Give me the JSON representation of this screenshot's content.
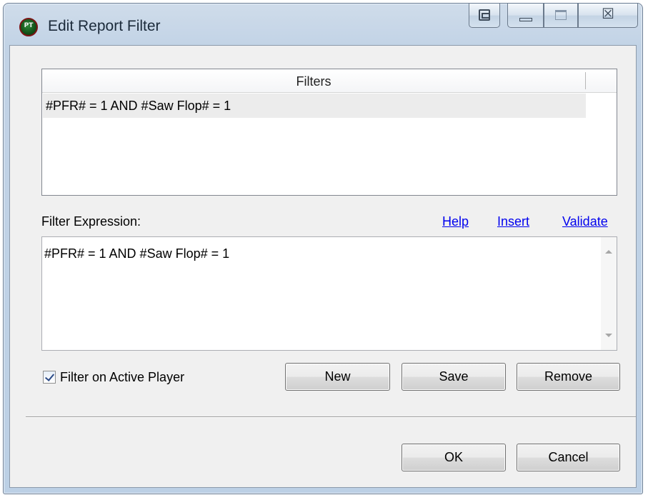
{
  "window": {
    "title": "Edit Report Filter",
    "icon": "app-logo-icon",
    "controls": {
      "extra_icon": "restore-window-icon",
      "minimize_icon": "minimize-icon",
      "maximize_icon": "maximize-icon",
      "close_glyph": "☒",
      "close_icon": "close-icon"
    }
  },
  "filters_list": {
    "header": "Filters",
    "rows": [
      "#PFR# = 1 AND #Saw Flop# = 1"
    ]
  },
  "expression": {
    "label": "Filter Expression:",
    "links": {
      "help": "Help",
      "insert": "Insert",
      "validate": "Validate"
    },
    "value": "#PFR# = 1 AND #Saw Flop# = 1"
  },
  "options": {
    "active_player_label": "Filter on Active Player",
    "active_player_checked": true
  },
  "buttons": {
    "new": "New",
    "save": "Save",
    "remove": "Remove",
    "ok": "OK",
    "cancel": "Cancel"
  },
  "colors": {
    "link": "#0000ee",
    "frame": "#bcd0e5",
    "client_bg": "#f0f0f0"
  }
}
